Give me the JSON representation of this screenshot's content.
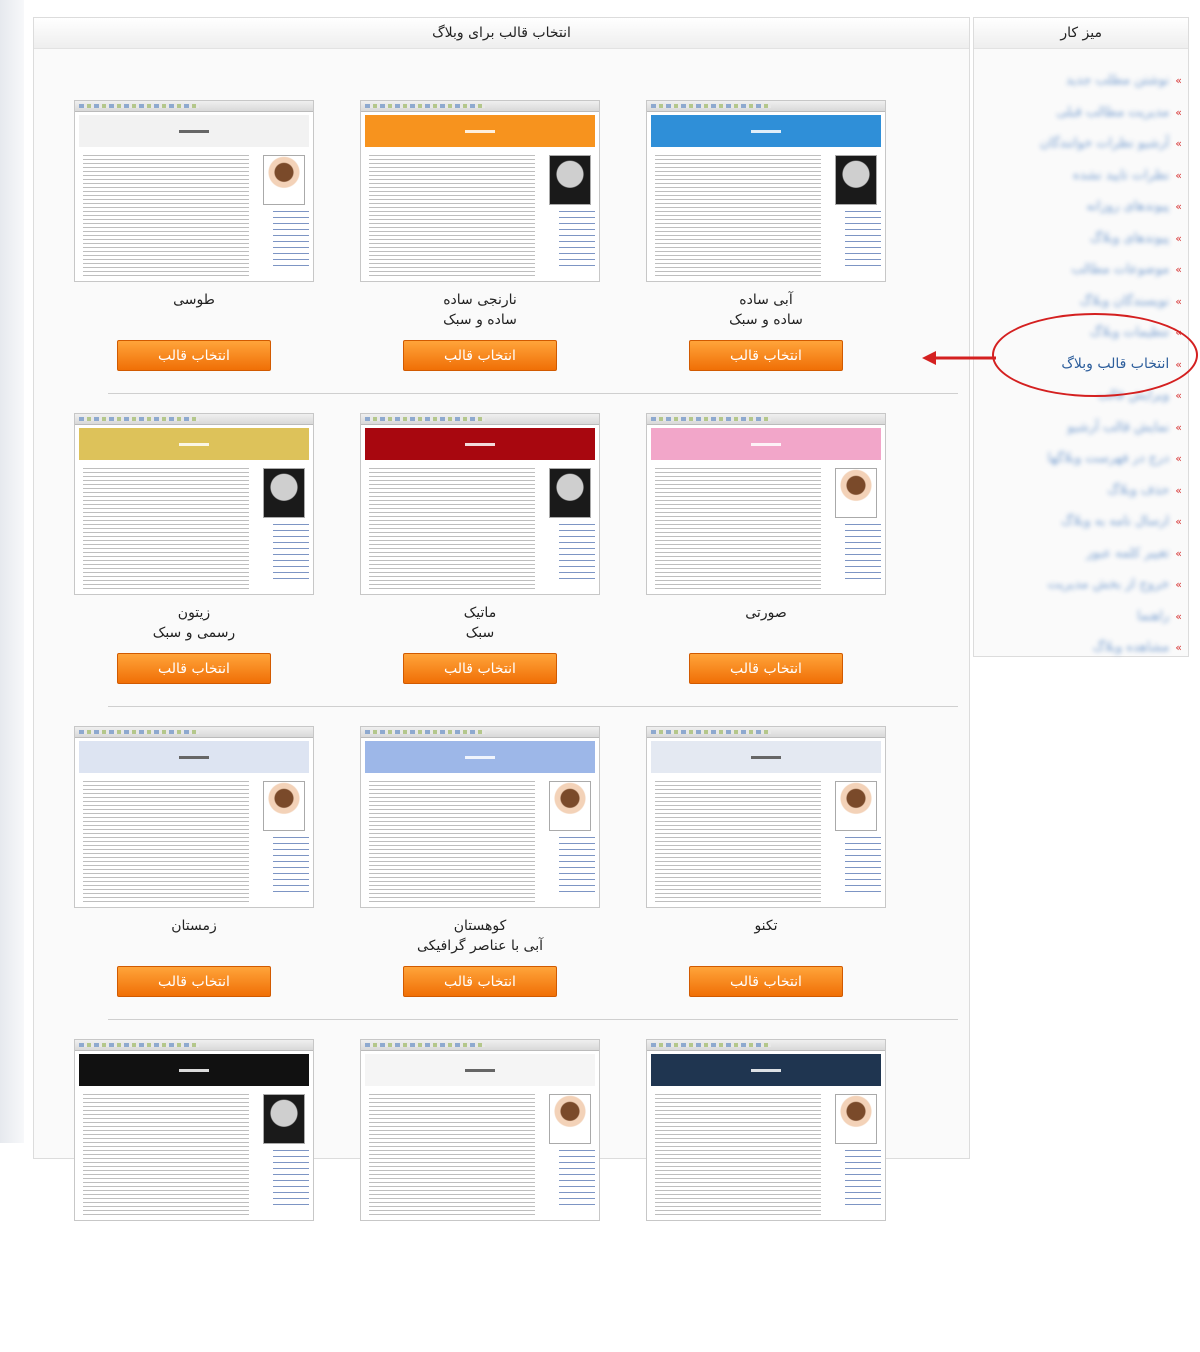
{
  "page": {
    "main_title": "انتخاب قالب برای وبلاگ",
    "sidebar_title": "میز کار"
  },
  "sidebar": {
    "items": [
      {
        "label": "نوشتن مطلب جدید",
        "active": false
      },
      {
        "label": "مدیریت مطالب قبلی",
        "active": false
      },
      {
        "label": "آرشیو نظرات خوانندگان",
        "active": false
      },
      {
        "label": "نظرات تایید نشده",
        "active": false
      },
      {
        "label": "پیوندهای روزانه",
        "active": false
      },
      {
        "label": "پیوندهای وبلاگ",
        "active": false
      },
      {
        "label": "موضوعات مطالب",
        "active": false
      },
      {
        "label": "نویسندگان وبلاگ",
        "active": false
      },
      {
        "label": "تنظیمات وبلاگ",
        "active": false
      },
      {
        "label": "انتخاب قالب وبلاگ",
        "active": true
      },
      {
        "label": "ویرایش قالب",
        "active": false
      },
      {
        "label": "نمایش قالب آرشیو",
        "active": false
      },
      {
        "label": "درج در فهرست وبلاگها",
        "active": false
      },
      {
        "label": "حذف وبلاگ",
        "active": false
      },
      {
        "label": "ارسال نامه به وبلاگ",
        "active": false
      },
      {
        "label": "تغییر کلمه عبور",
        "active": false
      },
      {
        "label": "خروج از بخش مدیریت",
        "active": false
      },
      {
        "label": "راهنما",
        "active": false
      },
      {
        "label": "مشاهده وبلاگ",
        "active": false
      }
    ]
  },
  "select_button_label": "انتخاب قالب",
  "templates": [
    {
      "name": "آبی ساده",
      "subtitle": "ساده و سبک",
      "header_color": "#2f8fd8",
      "photo": "dark"
    },
    {
      "name": "نارنجی ساده",
      "subtitle": "ساده و سبک",
      "header_color": "#f7931e",
      "photo": "dark"
    },
    {
      "name": "طوسی",
      "subtitle": "",
      "header_color": "#f2f2f2",
      "photo": "kid"
    },
    {
      "name": "صورتی",
      "subtitle": "",
      "header_color": "#f2a6c9",
      "photo": "kid"
    },
    {
      "name": "ماتیک",
      "subtitle": "سبک",
      "header_color": "#a8070f",
      "photo": "dark"
    },
    {
      "name": "زیتون",
      "subtitle": "رسمی و سبک",
      "header_color": "#ddc25a",
      "photo": "dark"
    },
    {
      "name": "تکنو",
      "subtitle": "",
      "header_color": "#e4e9f2",
      "photo": "kid"
    },
    {
      "name": "کوهستان",
      "subtitle": "آبی با عناصر گرافیکی",
      "header_color": "#9db7e8",
      "photo": "kid"
    },
    {
      "name": "زمستان",
      "subtitle": "",
      "header_color": "#dde4f2",
      "photo": "kid"
    },
    {
      "name": "",
      "subtitle": "",
      "header_color": "#1f3550",
      "photo": "kid"
    },
    {
      "name": "",
      "subtitle": "",
      "header_color": "#f5f5f5",
      "photo": "kid"
    },
    {
      "name": "",
      "subtitle": "",
      "header_color": "#111111",
      "photo": "dark"
    }
  ],
  "colors": {
    "accent_orange": "#f57d0f",
    "link_blue": "#2d5e9c",
    "highlight_red": "#d42020"
  }
}
